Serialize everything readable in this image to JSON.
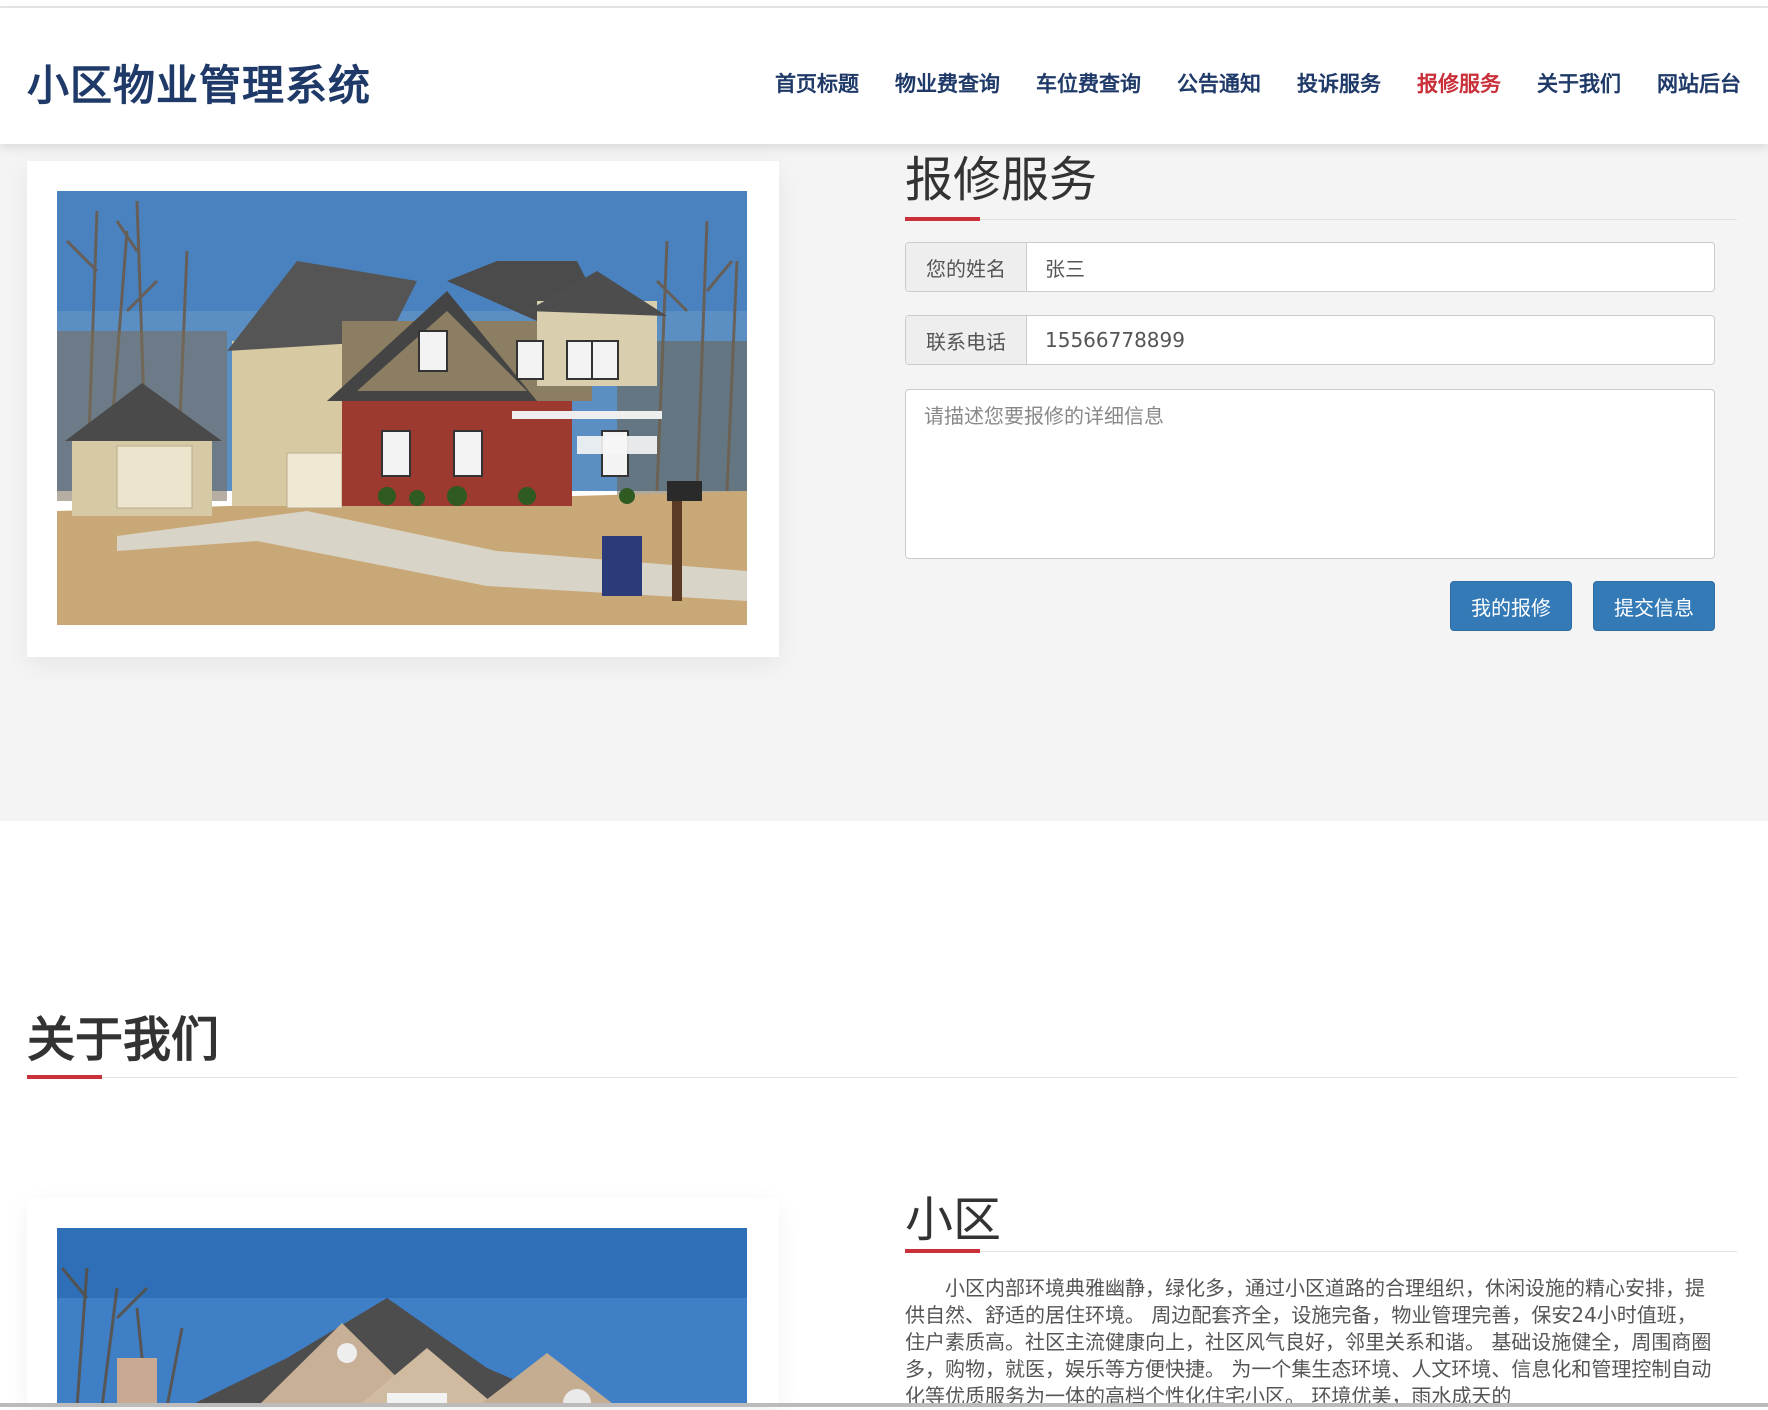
{
  "header": {
    "brand": "小区物业管理系统",
    "nav": [
      {
        "label": "首页标题"
      },
      {
        "label": "物业费查询"
      },
      {
        "label": "车位费查询"
      },
      {
        "label": "公告通知"
      },
      {
        "label": "投诉服务"
      },
      {
        "label": "报修服务",
        "active": true
      },
      {
        "label": "关于我们"
      },
      {
        "label": "网站后台"
      }
    ]
  },
  "repair": {
    "title": "报修服务",
    "name_label": "您的姓名",
    "name_value": "张三",
    "phone_label": "联系电话",
    "phone_value": "15566778899",
    "detail_placeholder": "请描述您要报修的详细信息",
    "my_repairs_button": "我的报修",
    "submit_button": "提交信息"
  },
  "about": {
    "title": "关于我们",
    "subtitle": "小区",
    "paragraph": "小区内部环境典雅幽静，绿化多，通过小区道路的合理组织，休闲设施的精心安排，提供自然、舒适的居住环境。 周边配套齐全，设施完备，物业管理完善，保安24小时值班，住户素质高。社区主流健康向上，社区风气良好，邻里关系和谐。 基础设施健全，周围商圈多，购物，就医，娱乐等方便快捷。 为一个集生态环境、人文环境、信息化和管理控制自动化等优质服务为一体的高档个性化住宅小区。 环境优美，雨水成天的"
  },
  "colors": {
    "brand": "#1f3a68",
    "accent_red": "#c9303a",
    "button_blue": "#337ab7"
  }
}
